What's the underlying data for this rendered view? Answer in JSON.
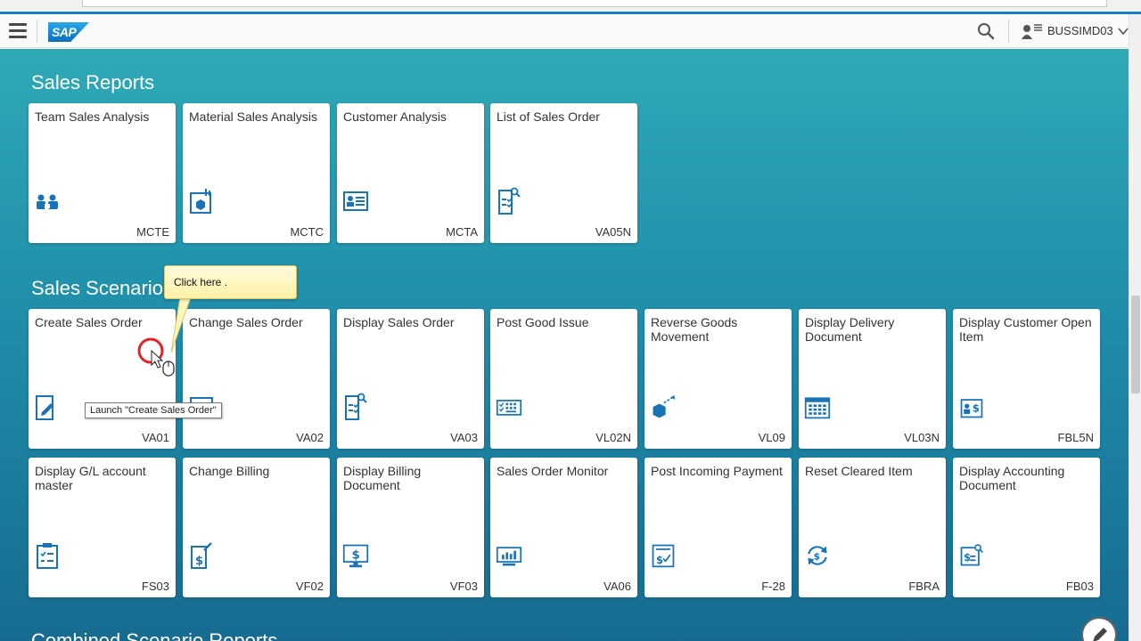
{
  "header": {
    "logo_text": "SAP",
    "user_name": "BUSSIMD03",
    "icons": {
      "menu": "hamburger-menu-icon",
      "search": "search-icon",
      "user": "user-icon",
      "chevron": "chevron-down-icon"
    }
  },
  "groups": [
    {
      "title": "Sales Reports",
      "tiles": [
        {
          "title": "Team Sales Analysis",
          "code": "MCTE",
          "icon": "team-analysis-icon"
        },
        {
          "title": "Material Sales Analysis",
          "code": "MCTC",
          "icon": "material-analysis-icon"
        },
        {
          "title": "Customer Analysis",
          "code": "MCTA",
          "icon": "customer-card-icon"
        },
        {
          "title": "List of Sales Order",
          "code": "VA05N",
          "icon": "list-search-icon"
        }
      ]
    },
    {
      "title": "Sales Scenario",
      "tiles": [
        {
          "title": "Create Sales Order",
          "code": "VA01",
          "icon": "edit-document-icon"
        },
        {
          "title": "Change Sales Order",
          "code": "VA02",
          "icon": "change-document-icon"
        },
        {
          "title": "Display Sales Order",
          "code": "VA03",
          "icon": "display-document-icon"
        },
        {
          "title": "Post Good Issue",
          "code": "VL02N",
          "icon": "keyboard-list-icon"
        },
        {
          "title": "Reverse Goods Movement",
          "code": "VL09",
          "icon": "shipping-box-icon"
        },
        {
          "title": "Display Delivery Document",
          "code": "VL03N",
          "icon": "calendar-grid-icon"
        },
        {
          "title": "Display Customer Open Item",
          "code": "FBL5N",
          "icon": "customer-money-icon"
        },
        {
          "title": "Display G/L account master",
          "code": "FS03",
          "icon": "checklist-icon"
        },
        {
          "title": "Change Billing",
          "code": "VF02",
          "icon": "billing-edit-icon"
        },
        {
          "title": "Display Billing Document",
          "code": "VF03",
          "icon": "billing-monitor-icon"
        },
        {
          "title": "Sales Order Monitor",
          "code": "VA06",
          "icon": "chart-monitor-icon"
        },
        {
          "title": "Post Incoming Payment",
          "code": "F-28",
          "icon": "payment-document-icon"
        },
        {
          "title": "Reset Cleared Item",
          "code": "FBRA",
          "icon": "refresh-money-icon"
        },
        {
          "title": "Display Accounting Document",
          "code": "FB03",
          "icon": "money-search-icon"
        }
      ]
    },
    {
      "title": "Combined Scenario Reports",
      "tiles": []
    }
  ],
  "tour": {
    "callout_text": "Click here .",
    "tooltip_text": "Launch \"Create Sales Order\""
  },
  "colors": {
    "accent": "#1a7fc7",
    "icon": "#1a73b5",
    "callout_bg": "#fff6b8"
  }
}
